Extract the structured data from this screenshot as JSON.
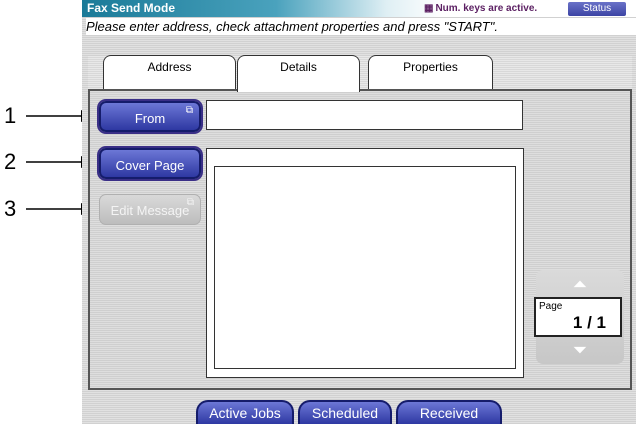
{
  "header": {
    "title": "Fax Send Mode",
    "numkeys_icon": "keypad-grid-icon",
    "numkeys_text": "Num. keys are active.",
    "status_label": "Status"
  },
  "instruction": "Please enter address, check attachment properties and press \"START\".",
  "tabs": [
    {
      "label": "Address"
    },
    {
      "label": "Details",
      "active": true
    },
    {
      "label": "Properties"
    }
  ],
  "buttons": {
    "from": "From",
    "cover_page": "Cover Page",
    "edit_message": "Edit Message"
  },
  "callouts": [
    "1",
    "2",
    "3"
  ],
  "pager": {
    "label": "Page",
    "value": "1 / 1",
    "up_icon": "double-chevron-up-icon",
    "down_icon": "double-chevron-down-icon"
  },
  "bottom_tabs": [
    "Active Jobs",
    "Scheduled",
    "Received"
  ],
  "colors": {
    "title_bar": "#1a7a98",
    "button_blue": "#3a44ae",
    "numkeys_text": "#5b1f62"
  }
}
